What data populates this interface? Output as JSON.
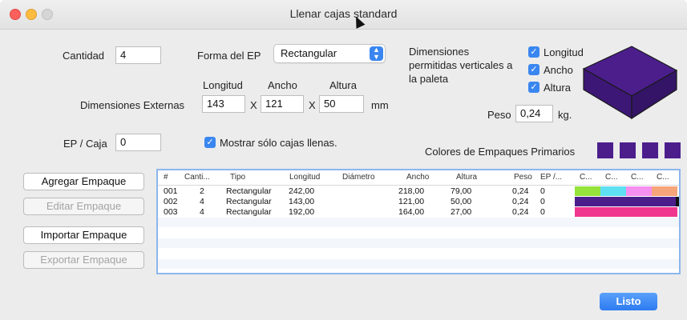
{
  "window": {
    "title": "Llenar cajas standard"
  },
  "form": {
    "cantidad_label": "Cantidad",
    "cantidad_value": "4",
    "forma_label": "Forma del EP",
    "forma_value": "Rectangular",
    "longitud_label": "Longitud",
    "ancho_label": "Ancho",
    "altura_label": "Altura",
    "dim_ext_label": "Dimensiones Externas",
    "longitud_value": "143",
    "ancho_value": "121",
    "altura_value": "50",
    "x1": "X",
    "x2": "X",
    "unit_mm": "mm",
    "ep_caja_label": "EP / Caja",
    "ep_caja_value": "0",
    "mostrar_label": "Mostrar sólo cajas llenas."
  },
  "dims": {
    "title_line1": "Dimensiones",
    "title_line2": "permitidas verticales a",
    "title_line3": "la paleta",
    "longitud": "Longitud",
    "ancho": "Ancho",
    "altura": "Altura",
    "peso_label": "Peso",
    "peso_value": "0,24",
    "peso_unit": "kg."
  },
  "colores_label": "Colores de Empaques Primarios",
  "colors": {
    "accent": "#3a86f0",
    "box": "#4b1e8c",
    "swatch": "#4b1e8c"
  },
  "buttons": {
    "agregar": "Agregar Empaque",
    "editar": "Editar Empaque",
    "importar": "Importar Empaque",
    "exportar": "Exportar Empaque",
    "listo": "Listo"
  },
  "table": {
    "headers": [
      "#",
      "Canti...",
      "Tipo",
      "Longitud",
      "Diámetro",
      "Ancho",
      "Altura",
      "Peso",
      "EP /...",
      "C...",
      "C...",
      "C...",
      "C..."
    ],
    "rows": [
      {
        "n": "001",
        "cant": "2",
        "tipo": "Rectangular",
        "long": "242,00",
        "diam": "",
        "ancho": "218,00",
        "altura": "79,00",
        "peso": "0,24",
        "ep": "0",
        "colors": [
          "#95e33b",
          "#5ee0f2",
          "#f58ff0",
          "#f6a57a"
        ]
      },
      {
        "n": "002",
        "cant": "4",
        "tipo": "Rectangular",
        "long": "143,00",
        "diam": "",
        "ancho": "121,00",
        "altura": "50,00",
        "peso": "0,24",
        "ep": "0",
        "colors": [
          "#4b1e8c",
          "#4b1e8c",
          "#4b1e8c",
          "#4b1e8c"
        ]
      },
      {
        "n": "003",
        "cant": "4",
        "tipo": "Rectangular",
        "long": "192,00",
        "diam": "",
        "ancho": "164,00",
        "altura": "27,00",
        "peso": "0,24",
        "ep": "0",
        "colors": [
          "#f0368e",
          "#f0368e",
          "#f0368e",
          "#f0368e"
        ]
      }
    ]
  }
}
